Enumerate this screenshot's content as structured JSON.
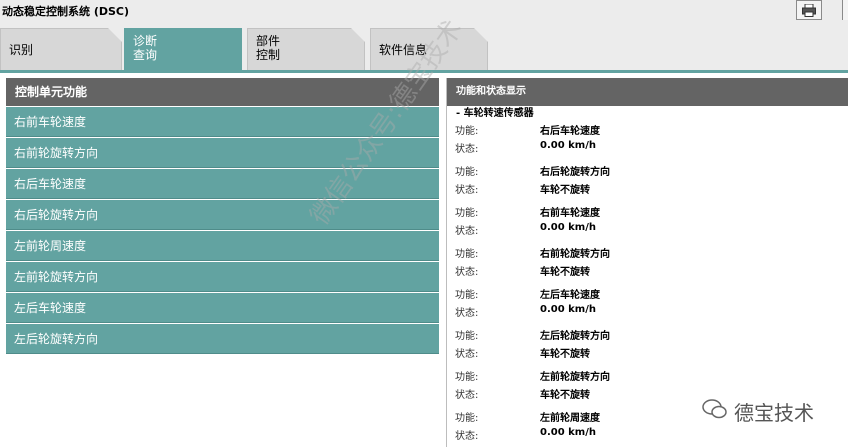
{
  "window": {
    "title": "动态稳定控制系统 (DSC)"
  },
  "tabs": [
    {
      "label": "识别"
    },
    {
      "label_line1": "诊断",
      "label_line2": "查询"
    },
    {
      "label_line1": "部件",
      "label_line2": "控制"
    },
    {
      "label": "软件信息"
    }
  ],
  "left_panel": {
    "header": "控制单元功能",
    "items": [
      "右前车轮速度",
      "右前轮旋转方向",
      "右后车轮速度",
      "右后轮旋转方向",
      "左前轮周速度",
      "左前轮旋转方向",
      "左后车轮速度",
      "左后轮旋转方向"
    ]
  },
  "right_panel": {
    "header": "功能和状态显示",
    "group_title": "- 车轮转速传感器",
    "function_label": "功能:",
    "status_label": "状态:",
    "entries": [
      {
        "function": "右后车轮速度",
        "status": "0.00 km/h"
      },
      {
        "function": "右后轮旋转方向",
        "status": "车轮不旋转"
      },
      {
        "function": "右前车轮速度",
        "status": "0.00 km/h"
      },
      {
        "function": "右前轮旋转方向",
        "status": "车轮不旋转"
      },
      {
        "function": "左后车轮速度",
        "status": "0.00 km/h"
      },
      {
        "function": "左后轮旋转方向",
        "status": "车轮不旋转"
      },
      {
        "function": "左前轮旋转方向",
        "status": "车轮不旋转"
      },
      {
        "function": "左前轮周速度",
        "status": "0.00 km/h"
      }
    ]
  },
  "watermark": "微信公众号:德宝技术",
  "brand": "德宝技术",
  "colors": {
    "accent": "#62a3a1",
    "header": "#646464"
  }
}
